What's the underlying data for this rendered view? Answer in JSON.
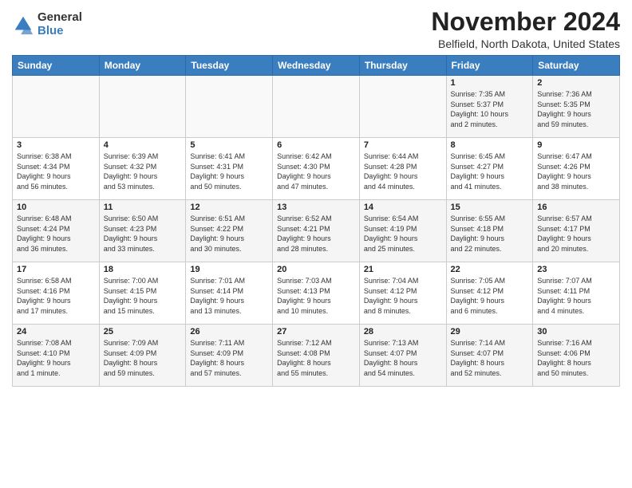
{
  "logo": {
    "general": "General",
    "blue": "Blue"
  },
  "header": {
    "title": "November 2024",
    "subtitle": "Belfield, North Dakota, United States"
  },
  "days_of_week": [
    "Sunday",
    "Monday",
    "Tuesday",
    "Wednesday",
    "Thursday",
    "Friday",
    "Saturday"
  ],
  "weeks": [
    [
      {
        "day": "",
        "info": ""
      },
      {
        "day": "",
        "info": ""
      },
      {
        "day": "",
        "info": ""
      },
      {
        "day": "",
        "info": ""
      },
      {
        "day": "",
        "info": ""
      },
      {
        "day": "1",
        "info": "Sunrise: 7:35 AM\nSunset: 5:37 PM\nDaylight: 10 hours\nand 2 minutes."
      },
      {
        "day": "2",
        "info": "Sunrise: 7:36 AM\nSunset: 5:35 PM\nDaylight: 9 hours\nand 59 minutes."
      }
    ],
    [
      {
        "day": "3",
        "info": "Sunrise: 6:38 AM\nSunset: 4:34 PM\nDaylight: 9 hours\nand 56 minutes."
      },
      {
        "day": "4",
        "info": "Sunrise: 6:39 AM\nSunset: 4:32 PM\nDaylight: 9 hours\nand 53 minutes."
      },
      {
        "day": "5",
        "info": "Sunrise: 6:41 AM\nSunset: 4:31 PM\nDaylight: 9 hours\nand 50 minutes."
      },
      {
        "day": "6",
        "info": "Sunrise: 6:42 AM\nSunset: 4:30 PM\nDaylight: 9 hours\nand 47 minutes."
      },
      {
        "day": "7",
        "info": "Sunrise: 6:44 AM\nSunset: 4:28 PM\nDaylight: 9 hours\nand 44 minutes."
      },
      {
        "day": "8",
        "info": "Sunrise: 6:45 AM\nSunset: 4:27 PM\nDaylight: 9 hours\nand 41 minutes."
      },
      {
        "day": "9",
        "info": "Sunrise: 6:47 AM\nSunset: 4:26 PM\nDaylight: 9 hours\nand 38 minutes."
      }
    ],
    [
      {
        "day": "10",
        "info": "Sunrise: 6:48 AM\nSunset: 4:24 PM\nDaylight: 9 hours\nand 36 minutes."
      },
      {
        "day": "11",
        "info": "Sunrise: 6:50 AM\nSunset: 4:23 PM\nDaylight: 9 hours\nand 33 minutes."
      },
      {
        "day": "12",
        "info": "Sunrise: 6:51 AM\nSunset: 4:22 PM\nDaylight: 9 hours\nand 30 minutes."
      },
      {
        "day": "13",
        "info": "Sunrise: 6:52 AM\nSunset: 4:21 PM\nDaylight: 9 hours\nand 28 minutes."
      },
      {
        "day": "14",
        "info": "Sunrise: 6:54 AM\nSunset: 4:19 PM\nDaylight: 9 hours\nand 25 minutes."
      },
      {
        "day": "15",
        "info": "Sunrise: 6:55 AM\nSunset: 4:18 PM\nDaylight: 9 hours\nand 22 minutes."
      },
      {
        "day": "16",
        "info": "Sunrise: 6:57 AM\nSunset: 4:17 PM\nDaylight: 9 hours\nand 20 minutes."
      }
    ],
    [
      {
        "day": "17",
        "info": "Sunrise: 6:58 AM\nSunset: 4:16 PM\nDaylight: 9 hours\nand 17 minutes."
      },
      {
        "day": "18",
        "info": "Sunrise: 7:00 AM\nSunset: 4:15 PM\nDaylight: 9 hours\nand 15 minutes."
      },
      {
        "day": "19",
        "info": "Sunrise: 7:01 AM\nSunset: 4:14 PM\nDaylight: 9 hours\nand 13 minutes."
      },
      {
        "day": "20",
        "info": "Sunrise: 7:03 AM\nSunset: 4:13 PM\nDaylight: 9 hours\nand 10 minutes."
      },
      {
        "day": "21",
        "info": "Sunrise: 7:04 AM\nSunset: 4:12 PM\nDaylight: 9 hours\nand 8 minutes."
      },
      {
        "day": "22",
        "info": "Sunrise: 7:05 AM\nSunset: 4:12 PM\nDaylight: 9 hours\nand 6 minutes."
      },
      {
        "day": "23",
        "info": "Sunrise: 7:07 AM\nSunset: 4:11 PM\nDaylight: 9 hours\nand 4 minutes."
      }
    ],
    [
      {
        "day": "24",
        "info": "Sunrise: 7:08 AM\nSunset: 4:10 PM\nDaylight: 9 hours\nand 1 minute."
      },
      {
        "day": "25",
        "info": "Sunrise: 7:09 AM\nSunset: 4:09 PM\nDaylight: 8 hours\nand 59 minutes."
      },
      {
        "day": "26",
        "info": "Sunrise: 7:11 AM\nSunset: 4:09 PM\nDaylight: 8 hours\nand 57 minutes."
      },
      {
        "day": "27",
        "info": "Sunrise: 7:12 AM\nSunset: 4:08 PM\nDaylight: 8 hours\nand 55 minutes."
      },
      {
        "day": "28",
        "info": "Sunrise: 7:13 AM\nSunset: 4:07 PM\nDaylight: 8 hours\nand 54 minutes."
      },
      {
        "day": "29",
        "info": "Sunrise: 7:14 AM\nSunset: 4:07 PM\nDaylight: 8 hours\nand 52 minutes."
      },
      {
        "day": "30",
        "info": "Sunrise: 7:16 AM\nSunset: 4:06 PM\nDaylight: 8 hours\nand 50 minutes."
      }
    ]
  ]
}
